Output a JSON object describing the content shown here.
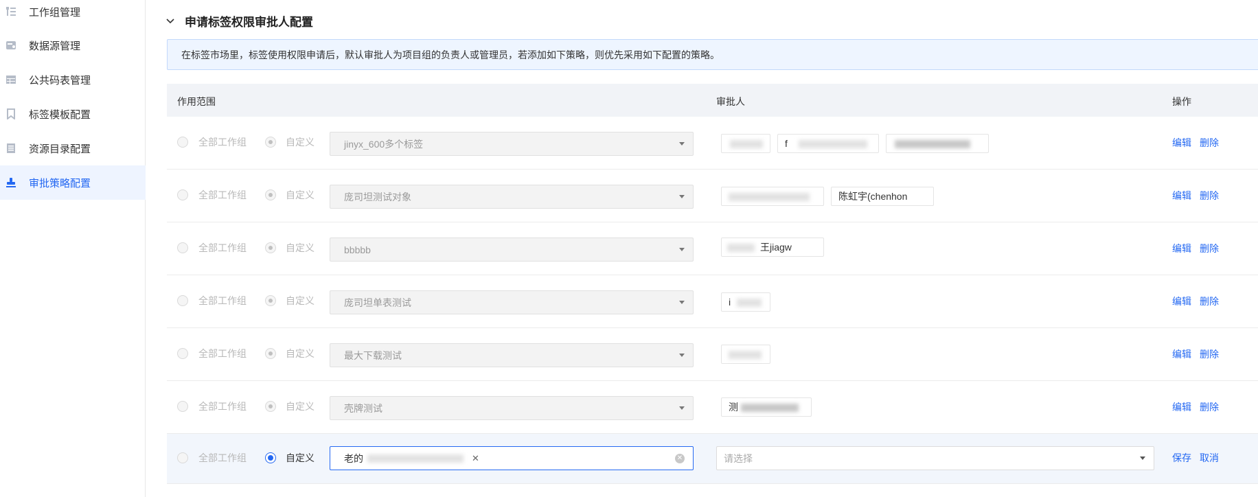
{
  "sidebar": {
    "items": [
      {
        "label": "工作组管理",
        "icon": "org-tree-icon",
        "active": false
      },
      {
        "label": "数据源管理",
        "icon": "database-icon",
        "active": false
      },
      {
        "label": "公共码表管理",
        "icon": "table-icon",
        "active": false
      },
      {
        "label": "标签模板配置",
        "icon": "bookmark-icon",
        "active": false
      },
      {
        "label": "资源目录配置",
        "icon": "document-icon",
        "active": false
      },
      {
        "label": "审批策略配置",
        "icon": "stamp-icon",
        "active": true
      }
    ]
  },
  "section": {
    "title": "申请标签权限审批人配置"
  },
  "notice": {
    "text": "在标签市场里，标签使用权限申请后，默认审批人为项目组的负责人或管理员，若添加如下策略，则优先采用如下配置的策略。"
  },
  "table": {
    "headers": {
      "scope": "作用范围",
      "approver": "审批人",
      "actions": "操作"
    },
    "radio_all": "全部工作组",
    "radio_custom": "自定义",
    "edit_label": "编辑",
    "delete_label": "删除",
    "save_label": "保存",
    "cancel_label": "取消",
    "rows": [
      {
        "scope_value": "jinyx_600多个标签",
        "approvers": [
          "",
          "f",
          ""
        ]
      },
      {
        "scope_value": "庞司坦测试对象",
        "approvers": [
          "",
          "陈虹宇(chenhon"
        ]
      },
      {
        "scope_value": "bbbbb",
        "approvers": [
          "王jiagw"
        ]
      },
      {
        "scope_value": "庞司坦单表测试",
        "approvers": [
          "i"
        ]
      },
      {
        "scope_value": "最大下载测试",
        "approvers": [
          ""
        ]
      },
      {
        "scope_value": "壳牌测试",
        "approvers": [
          "测"
        ]
      }
    ],
    "editing_row": {
      "scope_tag": "老的",
      "approver_placeholder": "请选择"
    }
  },
  "colors": {
    "accent": "#2468f2",
    "notice_bg": "#eef5ff",
    "header_bg": "#f1f3f7"
  }
}
